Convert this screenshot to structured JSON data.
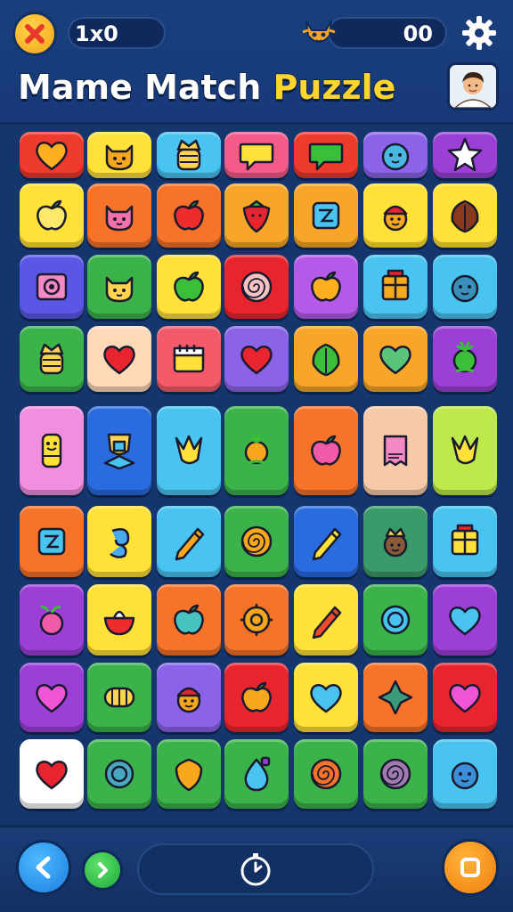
{
  "header": {
    "score_label": "1x0",
    "coins_label": "00",
    "title_words": [
      "Mame",
      "Match",
      "Puzzle"
    ]
  },
  "icons": {
    "close": "close-icon",
    "fox": "fox-icon",
    "settings": "gear-icon",
    "avatar": "avatar-icon",
    "back": "back-arrow-icon",
    "next": "chevron-right-icon",
    "timer": "stopwatch-icon",
    "menu": "square-icon"
  },
  "colors": {
    "background": "#15356d",
    "title_accent": "#ffd52e"
  },
  "board": {
    "rows": [
      [
        {
          "bg": "#ef3a2e",
          "icon": "heart",
          "fg": "#ffb020"
        },
        {
          "bg": "#ffe13a",
          "icon": "cat",
          "fg": "#f7a71c"
        },
        {
          "bg": "#49c3f0",
          "icon": "crown-jar",
          "fg": "#ffd34d"
        },
        {
          "bg": "#f45b8a",
          "icon": "speech-bubble",
          "fg": "#ffe13a"
        },
        {
          "bg": "#ef3a2e",
          "icon": "speech-bubble",
          "fg": "#3bbf3a"
        },
        {
          "bg": "#8a63e8",
          "icon": "face",
          "fg": "#49b8e0"
        },
        {
          "bg": "#9b3fd6",
          "icon": "star",
          "fg": "#ffffff"
        }
      ],
      [
        {
          "bg": "#ffe13a",
          "icon": "apple",
          "fg": "#ffe96a"
        },
        {
          "bg": "#f7732a",
          "icon": "cat",
          "fg": "#f56fa8"
        },
        {
          "bg": "#f7732a",
          "icon": "apple",
          "fg": "#ee2c2c"
        },
        {
          "bg": "#f7a62a",
          "icon": "strawberry",
          "fg": "#e8252e"
        },
        {
          "bg": "#f7a62a",
          "icon": "square-glyph",
          "fg": "#49c3f0"
        },
        {
          "bg": "#ffe13a",
          "icon": "face-hat",
          "fg": "#f7a71c"
        },
        {
          "bg": "#ffe13a",
          "icon": "leaf",
          "fg": "#8a3a1c"
        }
      ],
      [
        {
          "bg": "#5a57e6",
          "icon": "speaker",
          "fg": "#f589c4"
        },
        {
          "bg": "#3bb34a",
          "icon": "cat",
          "fg": "#ffd34d"
        },
        {
          "bg": "#ffe13a",
          "icon": "apple",
          "fg": "#3bbf3a"
        },
        {
          "bg": "#e8252e",
          "icon": "spiral",
          "fg": "#f7c2c2"
        },
        {
          "bg": "#b55ae8",
          "icon": "apple",
          "fg": "#ffb020"
        },
        {
          "bg": "#49c3f0",
          "icon": "box",
          "fg": "#f7a71c"
        },
        {
          "bg": "#49c3f0",
          "icon": "face",
          "fg": "#3a8fb8"
        }
      ],
      [
        {
          "bg": "#3bb34a",
          "icon": "crown-jar",
          "fg": "#ffd34d"
        },
        {
          "bg": "#ffd9b8",
          "icon": "heart",
          "fg": "#e8252e"
        },
        {
          "bg": "#f45b6a",
          "icon": "calendar",
          "fg": "#ffe13a"
        },
        {
          "bg": "#8a63e8",
          "icon": "heart",
          "fg": "#e8252e"
        },
        {
          "bg": "#f7a62a",
          "icon": "leaf",
          "fg": "#3bbf3a"
        },
        {
          "bg": "#f7a62a",
          "icon": "heart",
          "fg": "#5ac47a"
        },
        {
          "bg": "#9b3fd6",
          "icon": "flower",
          "fg": "#3bbf3a"
        }
      ],
      [
        {
          "bg": "#f18ee0",
          "icon": "bottle",
          "fg": "#ffe13a"
        },
        {
          "bg": "#2a6be0",
          "icon": "trophy",
          "fg": "#ffd34d"
        },
        {
          "bg": "#49c3f0",
          "icon": "crown",
          "fg": "#ffe13a"
        },
        {
          "bg": "#3bb34a",
          "icon": "flower",
          "fg": "#f7a71c"
        },
        {
          "bg": "#f7732a",
          "icon": "apple",
          "fg": "#f05aa8"
        },
        {
          "bg": "#f6c9a8",
          "icon": "packet",
          "fg": "#f589c4"
        },
        {
          "bg": "#bde94a",
          "icon": "crown",
          "fg": "#ffe13a"
        }
      ],
      [
        {
          "bg": "#f7732a",
          "icon": "square-glyph",
          "fg": "#49c3f0"
        },
        {
          "bg": "#ffe13a",
          "icon": "swirl",
          "fg": "#49a8f0"
        },
        {
          "bg": "#49c3f0",
          "icon": "pencil",
          "fg": "#f7a71c"
        },
        {
          "bg": "#3bb34a",
          "icon": "spiral",
          "fg": "#f7a71c"
        },
        {
          "bg": "#2a6be0",
          "icon": "pencil",
          "fg": "#ffe13a"
        },
        {
          "bg": "#3a9a6a",
          "icon": "face-crown",
          "fg": "#8a5a3a"
        },
        {
          "bg": "#49c3f0",
          "icon": "box",
          "fg": "#ffe13a"
        }
      ],
      [
        {
          "bg": "#9b3fd6",
          "icon": "berry",
          "fg": "#f05aa8"
        },
        {
          "bg": "#ffe13a",
          "icon": "bowl",
          "fg": "#ee2c2c"
        },
        {
          "bg": "#f7732a",
          "icon": "apple",
          "fg": "#49c3c0"
        },
        {
          "bg": "#f7732a",
          "icon": "gear",
          "fg": "#f7a71c"
        },
        {
          "bg": "#ffe13a",
          "icon": "pencil",
          "fg": "#ee4c2c"
        },
        {
          "bg": "#3bb34a",
          "icon": "ring",
          "fg": "#49c3f0"
        },
        {
          "bg": "#9b3fd6",
          "icon": "heart",
          "fg": "#49c3f0"
        }
      ],
      [
        {
          "bg": "#9b3fd6",
          "icon": "heart",
          "fg": "#f055d8"
        },
        {
          "bg": "#3bb34a",
          "icon": "roll",
          "fg": "#ffd34d"
        },
        {
          "bg": "#8a63e8",
          "icon": "face-hat",
          "fg": "#f7a71c"
        },
        {
          "bg": "#e8252e",
          "icon": "apple",
          "fg": "#f7a71c"
        },
        {
          "bg": "#ffe13a",
          "icon": "heart",
          "fg": "#49c3f0"
        },
        {
          "bg": "#f7732a",
          "icon": "star4",
          "fg": "#3a9a7a"
        },
        {
          "bg": "#e8252e",
          "icon": "heart",
          "fg": "#f055d8"
        }
      ],
      [
        {
          "bg": "#ffffff",
          "icon": "heart",
          "fg": "#e8252e"
        },
        {
          "bg": "#3bb34a",
          "icon": "ring",
          "fg": "#49a8c0"
        },
        {
          "bg": "#3bb34a",
          "icon": "shield",
          "fg": "#f7a71c"
        },
        {
          "bg": "#3bb34a",
          "icon": "drop",
          "fg": "#49c3f0"
        },
        {
          "bg": "#3bb34a",
          "icon": "spiral",
          "fg": "#f7732a"
        },
        {
          "bg": "#3bb34a",
          "icon": "spiral",
          "fg": "#a07ab0"
        },
        {
          "bg": "#49c3f0",
          "icon": "face",
          "fg": "#3a8fd8"
        }
      ]
    ]
  }
}
